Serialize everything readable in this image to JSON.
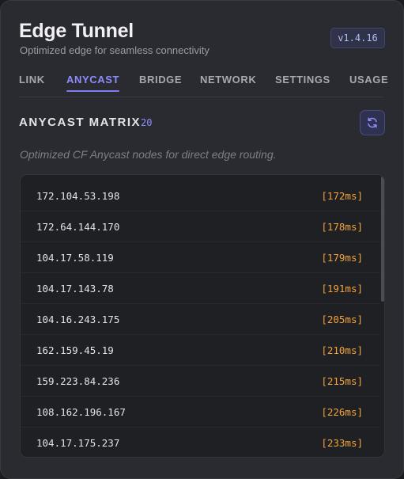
{
  "app": {
    "title": "Edge Tunnel",
    "subtitle": "Optimized edge for seamless connectivity",
    "version": "v1.4.16"
  },
  "tabs": [
    {
      "label": "LINK",
      "active": false
    },
    {
      "label": "ANYCAST",
      "active": true
    },
    {
      "label": "BRIDGE",
      "active": false
    },
    {
      "label": "NETWORK",
      "active": false
    },
    {
      "label": "SETTINGS",
      "active": false
    },
    {
      "label": "USAGE",
      "active": false
    }
  ],
  "section": {
    "title": "ANYCAST MATRIX",
    "count": "20",
    "refresh_icon": "refresh-icon",
    "description": "Optimized CF Anycast nodes for direct edge routing."
  },
  "nodes": [
    {
      "ip": "172.104.53.198",
      "latency": "[172ms]"
    },
    {
      "ip": "172.64.144.170",
      "latency": "[178ms]"
    },
    {
      "ip": "104.17.58.119",
      "latency": "[179ms]"
    },
    {
      "ip": "104.17.143.78",
      "latency": "[191ms]"
    },
    {
      "ip": "104.16.243.175",
      "latency": "[205ms]"
    },
    {
      "ip": "162.159.45.19",
      "latency": "[210ms]"
    },
    {
      "ip": "159.223.84.236",
      "latency": "[215ms]"
    },
    {
      "ip": "108.162.196.167",
      "latency": "[226ms]"
    },
    {
      "ip": "104.17.175.237",
      "latency": "[233ms]"
    }
  ],
  "colors": {
    "accent": "#8f8cff",
    "latency": "#f0a13a",
    "background": "#2a2b31"
  }
}
